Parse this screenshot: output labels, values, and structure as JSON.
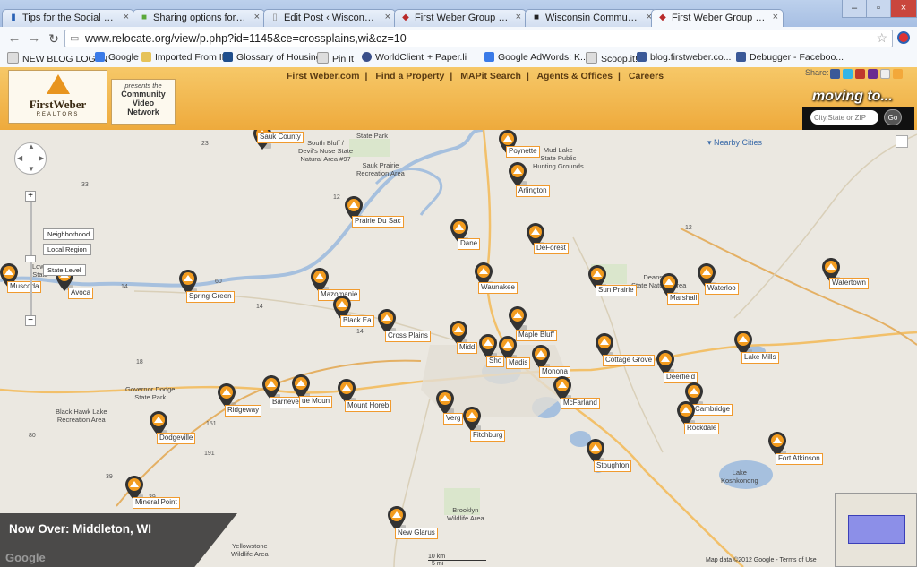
{
  "browser": {
    "tabs": [
      {
        "label": "Tips for the Social Marketi",
        "icon": "bars-icon",
        "active": false
      },
      {
        "label": "Sharing options for my ac",
        "icon": "green-leaf-icon",
        "active": false
      },
      {
        "label": "Edit Post ‹ Wisconsin Real",
        "icon": "page-icon",
        "active": false
      },
      {
        "label": "First Weber Group - Comm",
        "icon": "firstweber-icon",
        "active": false
      },
      {
        "label": "Wisconsin Community Inf",
        "icon": "black-square-icon",
        "active": false
      },
      {
        "label": "First Weber Group - Comm",
        "icon": "firstweber-icon",
        "active": true
      }
    ],
    "url": "www.relocate.org/view/p.php?id=1145&ce=crossplains,wi&cz=10",
    "bookmarks": [
      "NEW BLOG LOG IN",
      "Google",
      "Imported From IE",
      "Glossary of Housing...",
      "Pin It",
      "WorldClient",
      "+ Paper.li",
      "Google AdWords: K...",
      "Scoop.it!",
      "blog.firstweber.co...",
      "Debugger - Faceboo..."
    ]
  },
  "header": {
    "logo_text": "FirstWeber",
    "logo_sub": "REALTORS",
    "cvn_lines": [
      "presents the",
      "Community",
      "Video",
      "Network"
    ],
    "nav": [
      "First Weber.com",
      "Find a Property",
      "MAPit Search",
      "Agents & Offices",
      "Careers"
    ],
    "share_label": "Share:",
    "moving_title": "moving to...",
    "city_placeholder": "City,State or ZIP",
    "go_label": "Go"
  },
  "map": {
    "towns": [
      {
        "name": "Sauk County"
      },
      {
        "name": "Poynette"
      },
      {
        "name": "Arlington"
      },
      {
        "name": "Prairie Du Sac"
      },
      {
        "name": "Dane"
      },
      {
        "name": "DeForest"
      },
      {
        "name": "Waunakee"
      },
      {
        "name": "Sun Prairie"
      },
      {
        "name": "Marshall"
      },
      {
        "name": "Waterloo"
      },
      {
        "name": "Watertown"
      },
      {
        "name": "Muscoda"
      },
      {
        "name": "Avoca"
      },
      {
        "name": "Spring Green"
      },
      {
        "name": "Mazomanie"
      },
      {
        "name": "Black Ea"
      },
      {
        "name": "Cross Plains"
      },
      {
        "name": "Midd"
      },
      {
        "name": "Sho"
      },
      {
        "name": "Madis"
      },
      {
        "name": "Maple Bluff"
      },
      {
        "name": "Monona"
      },
      {
        "name": "Cottage Grove"
      },
      {
        "name": "Deerfield"
      },
      {
        "name": "Lake Mills"
      },
      {
        "name": "Cambridge"
      },
      {
        "name": "Rockdale"
      },
      {
        "name": "Ridgeway"
      },
      {
        "name": "Barneveld"
      },
      {
        "name": "ue Moun"
      },
      {
        "name": "Mount Horeb"
      },
      {
        "name": "Verg"
      },
      {
        "name": "Fitchburg"
      },
      {
        "name": "McFarland"
      },
      {
        "name": "Stoughton"
      },
      {
        "name": "Fort Atkinson"
      },
      {
        "name": "Dodgeville"
      },
      {
        "name": "Mineral Point"
      },
      {
        "name": "New Glarus"
      }
    ],
    "labels": [
      "State Park",
      "South Bluff /",
      "Devil's Nose State",
      "Natural Area #97",
      "Sauk Prairie",
      "Recreation Area",
      "Mud Lake",
      "State Public",
      "Hunting Grounds",
      "Deansville",
      "State Natural Area",
      "Governor Dodge",
      "State Park",
      "Black Hawk Lake",
      "Recreation Area",
      "Brooklyn",
      "Wildlife Area",
      "Yellowstone",
      "Wildlife Area",
      "Lake",
      "Koshkonong",
      "Lowe",
      "State"
    ],
    "highways": [
      "23",
      "12",
      "33",
      "12",
      "14",
      "60",
      "14",
      "14",
      "18",
      "151",
      "151",
      "80",
      "39",
      "191",
      "39"
    ],
    "controls": {
      "zoom_in": "+",
      "zoom_out": "−",
      "levels": [
        "Neighborhood",
        "Local Region",
        "State Level"
      ],
      "nearby_cities": "Nearby Cities"
    },
    "now_over": "Now Over: Middleton, WI",
    "scale": {
      "km": "10 km",
      "mi": "5 mi"
    },
    "attribution": "Map data ©2012 Google - Terms of Use",
    "google": "Google"
  },
  "colors": {
    "header_orange": "#f0b04a",
    "pin_orange": "#f39c1f",
    "label_border": "#f09a2e",
    "water": "#a6c0de"
  }
}
